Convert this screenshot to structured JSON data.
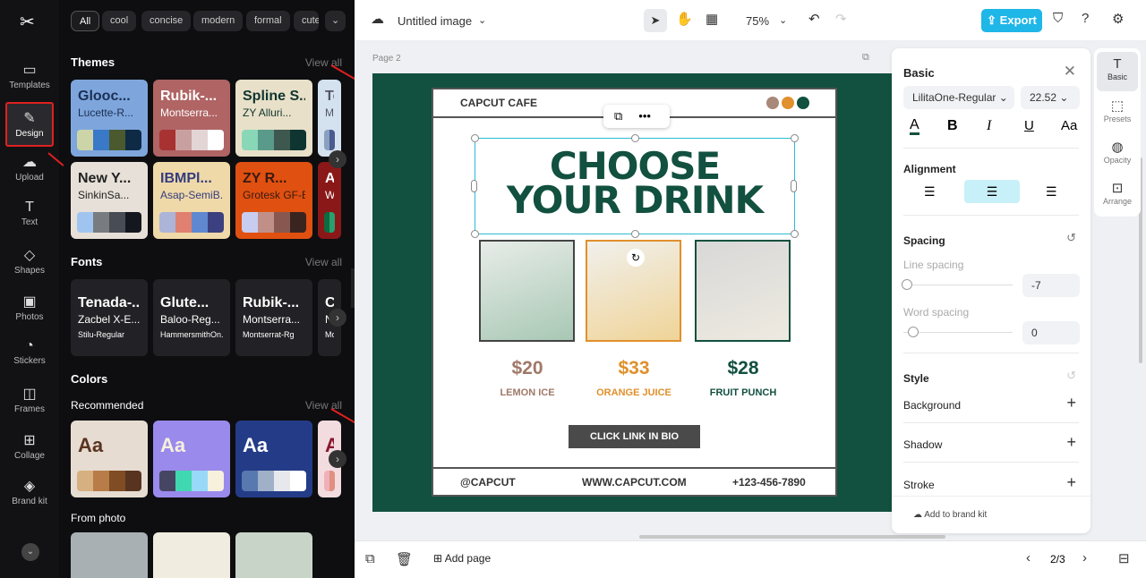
{
  "rail": {
    "items": [
      {
        "label": "Templates",
        "icon": "templates-icon"
      },
      {
        "label": "Design",
        "icon": "design-icon",
        "active": true
      },
      {
        "label": "Upload",
        "icon": "upload-icon"
      },
      {
        "label": "Text",
        "icon": "text-icon"
      },
      {
        "label": "Shapes",
        "icon": "shapes-icon"
      },
      {
        "label": "Photos",
        "icon": "photos-icon"
      },
      {
        "label": "Stickers",
        "icon": "stickers-icon"
      },
      {
        "label": "Frames",
        "icon": "frames-icon"
      },
      {
        "label": "Collage",
        "icon": "collage-icon"
      },
      {
        "label": "Brand kit",
        "icon": "brand-kit-icon"
      }
    ]
  },
  "panel": {
    "chips": [
      "All",
      "cool",
      "concise",
      "modern",
      "formal",
      "cute"
    ],
    "themes": {
      "title": "Themes",
      "view_all": "View all",
      "cards": [
        {
          "t1": "Glooc...",
          "t2": "Lucette-R...",
          "bg": "#7ea6dc",
          "fg": "#1b2f55",
          "sw": [
            "#cdd5a8",
            "#3a78c8",
            "#4a5a2e",
            "#0e2a44"
          ]
        },
        {
          "t1": "Rubik-...",
          "t2": "Montserra...",
          "bg": "#b06464",
          "fg": "#ffffff",
          "sw": [
            "#a83232",
            "#c9a0a0",
            "#e3d5d5",
            "#ffffff"
          ]
        },
        {
          "t1": "Spline S...",
          "t2": "ZY Alluri...",
          "bg": "#e8e0c8",
          "fg": "#0e3530",
          "sw": [
            "#88d8b8",
            "#5a9a8a",
            "#3e5850",
            "#0e3530"
          ]
        },
        {
          "t1": "Te...",
          "t2": "Mon...",
          "bg": "#d4e2f0",
          "fg": "#556",
          "sw": [
            "#8aa0c0",
            "#4a5a90"
          ]
        },
        {
          "t1": "New Y...",
          "t2": "SinkinSa...",
          "bg": "#e6e0d8",
          "fg": "#222",
          "sw": [
            "#a0c4f0",
            "#787c80",
            "#484c54",
            "#14181e"
          ]
        },
        {
          "t1": "IBMPl...",
          "t2": "Asap-SemiB...",
          "bg": "#efd9a8",
          "fg": "#343c80",
          "sw": [
            "#acb4d8",
            "#e08070",
            "#6088d0",
            "#3c4080"
          ]
        },
        {
          "t1": "ZY R...",
          "t2": "Grotesk GF-B...",
          "bg": "#e05010",
          "fg": "#3a1a10",
          "sw": [
            "#c8ccf0",
            "#c09088",
            "#885850",
            "#3a2420"
          ]
        },
        {
          "t1": "Anto...",
          "t2": "Wix...",
          "bg": "#8a1818",
          "fg": "#ffffff",
          "sw": [
            "#0e6a40",
            "#28a070"
          ]
        }
      ]
    },
    "fonts": {
      "title": "Fonts",
      "view_all": "View all",
      "cards": [
        {
          "t1": "Tenada-...",
          "t2": "Zacbel X-E...",
          "t3": "Stilu-Regular"
        },
        {
          "t1": "Glute...",
          "t2": "Baloo-Reg...",
          "t3": "HammersmithOn..."
        },
        {
          "t1": "Rubik-...",
          "t2": "Montserra...",
          "t3": "Montserrat-Rg"
        },
        {
          "t1": "Ch...",
          "t2": "N...",
          "t3": "Mont..."
        }
      ]
    },
    "colors": {
      "title": "Colors",
      "recommended": "Recommended",
      "view_all": "View all",
      "cards": [
        {
          "label": "Aa",
          "bg": "#e6dcd2",
          "fg": "#5a3420",
          "sw": [
            "#d6b080",
            "#b87c48",
            "#804c24",
            "#583420"
          ]
        },
        {
          "label": "Aa",
          "bg": "#9a8aec",
          "fg": "#f6f0dc",
          "sw": [
            "#464664",
            "#40d8b0",
            "#98d8f8",
            "#f6f0dc"
          ]
        },
        {
          "label": "Aa",
          "bg": "#243c88",
          "fg": "#ffffff",
          "sw": [
            "#5878b0",
            "#a0b0c8",
            "#e6e8ec",
            "#ffffff"
          ]
        },
        {
          "label": "Aa",
          "bg": "#f2dce0",
          "fg": "#881830",
          "sw": [
            "#f0b0b8",
            "#e09080"
          ]
        }
      ]
    },
    "from_photo": "From photo"
  },
  "topbar": {
    "title": "Untitled image",
    "zoom": "75%",
    "export": "Export"
  },
  "canvas": {
    "page_label": "Page 2",
    "cafe": "CAPCUT CAFE",
    "headline": "CHOOSE YOUR DRINK",
    "dots": [
      "#a88878",
      "#e0902c",
      "#12503f"
    ],
    "items": [
      {
        "price": "$20",
        "name": "LEMON ICE",
        "color": "#a07868"
      },
      {
        "price": "$33",
        "name": "ORANGE JUICE",
        "color": "#e0902c"
      },
      {
        "price": "$28",
        "name": "FRUIT PUNCH",
        "color": "#12503f"
      }
    ],
    "cta": "CLICK LINK IN BIO",
    "footer": [
      "@CAPCUT",
      "WWW.CAPCUT.COM",
      "+123-456-7890"
    ]
  },
  "props": {
    "title": "Basic",
    "font": "LilitaOne-Regular",
    "size": "22.52",
    "alignment": "Alignment",
    "spacing": "Spacing",
    "line_spacing": "Line spacing",
    "line_value": "-7",
    "word_spacing": "Word spacing",
    "word_value": "0",
    "style": "Style",
    "background": "Background",
    "shadow": "Shadow",
    "stroke": "Stroke",
    "brand": "Add to brand kit",
    "text_color": "#12503f"
  },
  "tabs": [
    "Basic",
    "Presets",
    "Opacity",
    "Arrange"
  ],
  "bottombar": {
    "add_page": "Add page",
    "page": "2/3"
  }
}
